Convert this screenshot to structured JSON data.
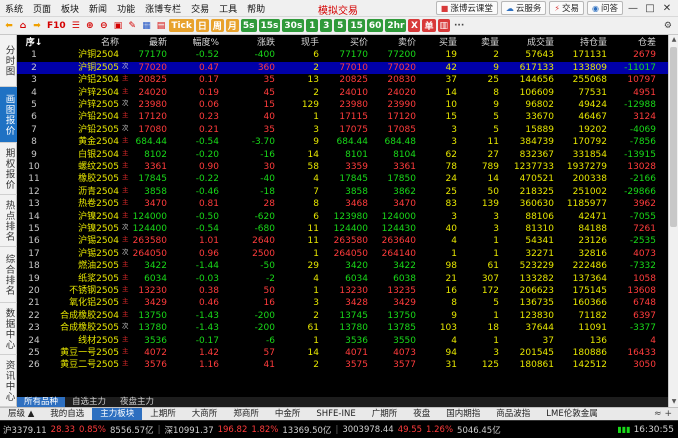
{
  "menu": {
    "items": [
      "系统",
      "页面",
      "板块",
      "新闻",
      "功能",
      "涨博专栏",
      "交易",
      "工具",
      "帮助"
    ],
    "title": "模拟交易",
    "right_buttons": [
      {
        "icon": "classroom-icon",
        "label": "涨博云课堂"
      },
      {
        "icon": "cloud-icon",
        "label": "云服务"
      },
      {
        "icon": "trade-icon",
        "label": "交易"
      },
      {
        "icon": "question-icon",
        "label": "问答"
      }
    ],
    "window_controls": [
      "—",
      "□",
      "✕"
    ]
  },
  "toolbar": {
    "f10": "F10",
    "tick": "Tick",
    "day": "日",
    "week": "周",
    "month": "月",
    "periods": [
      "5s",
      "15s",
      "30s",
      "1",
      "3",
      "5",
      "15",
      "60",
      "2hr"
    ],
    "x_btn": "X",
    "ex_btn": "单",
    "more": "···"
  },
  "sidebar": {
    "items": [
      "分时图",
      "画图报价",
      "期权报价",
      "热点排名",
      "综合排名",
      "数据中心",
      "资讯中心"
    ],
    "active_index": 1
  },
  "table": {
    "headers": {
      "seq": "序↓",
      "name": "名称",
      "last": "最新",
      "pct": "幅度%",
      "chg": "涨跌",
      "vol": "现手",
      "bid": "买价",
      "ask": "卖价",
      "bsz": "买量",
      "asz": "卖量",
      "turn": "成交量",
      "oi": "持仓量",
      "oichg": "仓差"
    },
    "selected_row": 1,
    "rows": [
      {
        "seq": "1",
        "name": "沪铜2504",
        "tag": "",
        "last": "77170",
        "pct": "-0.52",
        "chg": "-400",
        "vol": "6",
        "bid": "77170",
        "ask": "77200",
        "bsz": "19",
        "asz": "2",
        "turn": "57643",
        "oi": "171131",
        "oichg": "2679",
        "dir": "dn",
        "oidir": "up"
      },
      {
        "seq": "2",
        "name": "沪铜2505",
        "tag": "次",
        "last": "77020",
        "pct": "0.47",
        "chg": "360",
        "vol": "2",
        "bid": "77010",
        "ask": "77020",
        "bsz": "42",
        "asz": "9",
        "turn": "617133",
        "oi": "133809",
        "oichg": "-11017",
        "dir": "up",
        "oidir": "dn"
      },
      {
        "seq": "3",
        "name": "沪铝2504",
        "tag": "主",
        "last": "20825",
        "pct": "0.17",
        "chg": "35",
        "vol": "13",
        "bid": "20825",
        "ask": "20830",
        "bsz": "37",
        "asz": "25",
        "turn": "144656",
        "oi": "255068",
        "oichg": "10797",
        "dir": "up",
        "oidir": "up"
      },
      {
        "seq": "4",
        "name": "沪锌2504",
        "tag": "主",
        "last": "24020",
        "pct": "0.19",
        "chg": "45",
        "vol": "2",
        "bid": "24010",
        "ask": "24020",
        "bsz": "14",
        "asz": "8",
        "turn": "106609",
        "oi": "77531",
        "oichg": "4951",
        "dir": "up",
        "oidir": "up"
      },
      {
        "seq": "5",
        "name": "沪锌2505",
        "tag": "次",
        "last": "23980",
        "pct": "0.06",
        "chg": "15",
        "vol": "129",
        "bid": "23980",
        "ask": "23990",
        "bsz": "10",
        "asz": "9",
        "turn": "96802",
        "oi": "49424",
        "oichg": "-12988",
        "dir": "up",
        "oidir": "dn"
      },
      {
        "seq": "6",
        "name": "沪铅2504",
        "tag": "主",
        "last": "17120",
        "pct": "0.23",
        "chg": "40",
        "vol": "1",
        "bid": "17115",
        "ask": "17120",
        "bsz": "15",
        "asz": "5",
        "turn": "33670",
        "oi": "46467",
        "oichg": "3124",
        "dir": "up",
        "oidir": "up"
      },
      {
        "seq": "7",
        "name": "沪铅2505",
        "tag": "次",
        "last": "17080",
        "pct": "0.21",
        "chg": "35",
        "vol": "3",
        "bid": "17075",
        "ask": "17085",
        "bsz": "3",
        "asz": "5",
        "turn": "15889",
        "oi": "19202",
        "oichg": "-4069",
        "dir": "up",
        "oidir": "dn"
      },
      {
        "seq": "8",
        "name": "黄金2504",
        "tag": "主",
        "last": "684.44",
        "pct": "-0.54",
        "chg": "-3.70",
        "vol": "9",
        "bid": "684.44",
        "ask": "684.48",
        "bsz": "3",
        "asz": "11",
        "turn": "384739",
        "oi": "170792",
        "oichg": "-7856",
        "dir": "dn",
        "oidir": "dn"
      },
      {
        "seq": "9",
        "name": "白银2504",
        "tag": "主",
        "last": "8102",
        "pct": "-0.20",
        "chg": "-16",
        "vol": "14",
        "bid": "8101",
        "ask": "8104",
        "bsz": "62",
        "asz": "27",
        "turn": "832367",
        "oi": "331854",
        "oichg": "-13915",
        "dir": "dn",
        "oidir": "dn"
      },
      {
        "seq": "10",
        "name": "螺纹2505",
        "tag": "主",
        "last": "3361",
        "pct": "0.90",
        "chg": "30",
        "vol": "58",
        "bid": "3359",
        "ask": "3361",
        "bsz": "78",
        "asz": "789",
        "turn": "1237733",
        "oi": "1937279",
        "oichg": "13028",
        "dir": "up",
        "oidir": "up"
      },
      {
        "seq": "11",
        "name": "橡胶2505",
        "tag": "主",
        "last": "17845",
        "pct": "-0.22",
        "chg": "-40",
        "vol": "4",
        "bid": "17845",
        "ask": "17850",
        "bsz": "24",
        "asz": "14",
        "turn": "470521",
        "oi": "200338",
        "oichg": "-2166",
        "dir": "dn",
        "oidir": "dn"
      },
      {
        "seq": "12",
        "name": "沥青2504",
        "tag": "主",
        "last": "3858",
        "pct": "-0.46",
        "chg": "-18",
        "vol": "7",
        "bid": "3858",
        "ask": "3862",
        "bsz": "25",
        "asz": "50",
        "turn": "218325",
        "oi": "251002",
        "oichg": "-29866",
        "dir": "dn",
        "oidir": "dn"
      },
      {
        "seq": "13",
        "name": "热卷2505",
        "tag": "主",
        "last": "3470",
        "pct": "0.81",
        "chg": "28",
        "vol": "8",
        "bid": "3468",
        "ask": "3470",
        "bsz": "83",
        "asz": "139",
        "turn": "360630",
        "oi": "1185977",
        "oichg": "3962",
        "dir": "up",
        "oidir": "up"
      },
      {
        "seq": "14",
        "name": "沪镍2504",
        "tag": "主",
        "last": "124000",
        "pct": "-0.50",
        "chg": "-620",
        "vol": "6",
        "bid": "123980",
        "ask": "124000",
        "bsz": "3",
        "asz": "3",
        "turn": "88106",
        "oi": "42471",
        "oichg": "-7055",
        "dir": "dn",
        "oidir": "dn"
      },
      {
        "seq": "15",
        "name": "沪镍2505",
        "tag": "次",
        "last": "124400",
        "pct": "-0.54",
        "chg": "-680",
        "vol": "11",
        "bid": "124400",
        "ask": "124430",
        "bsz": "40",
        "asz": "3",
        "turn": "81310",
        "oi": "84188",
        "oichg": "7261",
        "dir": "dn",
        "oidir": "up"
      },
      {
        "seq": "16",
        "name": "沪锡2504",
        "tag": "主",
        "last": "263580",
        "pct": "1.01",
        "chg": "2640",
        "vol": "11",
        "bid": "263580",
        "ask": "263640",
        "bsz": "4",
        "asz": "1",
        "turn": "54341",
        "oi": "23126",
        "oichg": "-2535",
        "dir": "up",
        "oidir": "dn"
      },
      {
        "seq": "17",
        "name": "沪锡2505",
        "tag": "次",
        "last": "264050",
        "pct": "0.96",
        "chg": "2500",
        "vol": "1",
        "bid": "264050",
        "ask": "264140",
        "bsz": "1",
        "asz": "1",
        "turn": "32271",
        "oi": "32816",
        "oichg": "4073",
        "dir": "up",
        "oidir": "up"
      },
      {
        "seq": "18",
        "name": "燃油2505",
        "tag": "主",
        "last": "3422",
        "pct": "-1.44",
        "chg": "-50",
        "vol": "29",
        "bid": "3420",
        "ask": "3422",
        "bsz": "98",
        "asz": "61",
        "turn": "523229",
        "oi": "222486",
        "oichg": "-7332",
        "dir": "dn",
        "oidir": "dn"
      },
      {
        "seq": "19",
        "name": "纸浆2505",
        "tag": "主",
        "last": "6034",
        "pct": "-0.03",
        "chg": "-2",
        "vol": "4",
        "bid": "6034",
        "ask": "6038",
        "bsz": "21",
        "asz": "307",
        "turn": "133282",
        "oi": "137364",
        "oichg": "1058",
        "dir": "dn",
        "oidir": "up"
      },
      {
        "seq": "20",
        "name": "不锈钢2505",
        "tag": "主",
        "last": "13230",
        "pct": "0.38",
        "chg": "50",
        "vol": "1",
        "bid": "13230",
        "ask": "13235",
        "bsz": "16",
        "asz": "172",
        "turn": "206623",
        "oi": "175145",
        "oichg": "13608",
        "dir": "up",
        "oidir": "up"
      },
      {
        "seq": "21",
        "name": "氧化铝2505",
        "tag": "主",
        "last": "3429",
        "pct": "0.46",
        "chg": "16",
        "vol": "3",
        "bid": "3428",
        "ask": "3429",
        "bsz": "8",
        "asz": "5",
        "turn": "136735",
        "oi": "160366",
        "oichg": "6748",
        "dir": "up",
        "oidir": "up"
      },
      {
        "seq": "22",
        "name": "合成橡胶2504",
        "tag": "主",
        "last": "13750",
        "pct": "-1.43",
        "chg": "-200",
        "vol": "2",
        "bid": "13745",
        "ask": "13750",
        "bsz": "9",
        "asz": "1",
        "turn": "123830",
        "oi": "71182",
        "oichg": "6397",
        "dir": "dn",
        "oidir": "up"
      },
      {
        "seq": "23",
        "name": "合成橡胶2505",
        "tag": "次",
        "last": "13780",
        "pct": "-1.43",
        "chg": "-200",
        "vol": "61",
        "bid": "13780",
        "ask": "13785",
        "bsz": "103",
        "asz": "18",
        "turn": "37644",
        "oi": "11091",
        "oichg": "-3377",
        "dir": "dn",
        "oidir": "dn"
      },
      {
        "seq": "24",
        "name": "线材2505",
        "tag": "主",
        "last": "3536",
        "pct": "-0.17",
        "chg": "-6",
        "vol": "1",
        "bid": "3536",
        "ask": "3550",
        "bsz": "4",
        "asz": "1",
        "turn": "37",
        "oi": "136",
        "oichg": "4",
        "dir": "dn",
        "oidir": "up"
      },
      {
        "seq": "25",
        "name": "黄豆一号2505",
        "tag": "主",
        "last": "4072",
        "pct": "1.42",
        "chg": "57",
        "vol": "14",
        "bid": "4071",
        "ask": "4073",
        "bsz": "94",
        "asz": "3",
        "turn": "201545",
        "oi": "180886",
        "oichg": "16433",
        "dir": "up",
        "oidir": "up"
      },
      {
        "seq": "26",
        "name": "黄豆二号2505",
        "tag": "主",
        "last": "3576",
        "pct": "1.16",
        "chg": "41",
        "vol": "2",
        "bid": "3575",
        "ask": "3577",
        "bsz": "31",
        "asz": "125",
        "turn": "180861",
        "oi": "142512",
        "oichg": "3050",
        "dir": "up",
        "oidir": "up"
      }
    ]
  },
  "subtabs": {
    "items": [
      "所有品种",
      "自选主力",
      "夜盘主力"
    ],
    "active_index": 0
  },
  "boardtabs": {
    "items": [
      "层级 ▲",
      "我的自选",
      "主力板块",
      "上期所",
      "大商所",
      "郑商所",
      "中金所",
      "SHFE-INE",
      "广期所",
      "夜盘",
      "国内期指",
      "商品波指",
      "LME伦敦金属"
    ],
    "active_index": 2,
    "tail": "≈ +"
  },
  "status": {
    "segments": [
      {
        "text": "沪3379.11",
        "color": "w"
      },
      {
        "text": "28.33",
        "color": "r"
      },
      {
        "text": "0.85%",
        "color": "r"
      },
      {
        "text": "8556.57亿",
        "color": "w"
      },
      {
        "text": "|",
        "color": "sep"
      },
      {
        "text": "深10991.37",
        "color": "w"
      },
      {
        "text": "196.82",
        "color": "r"
      },
      {
        "text": "1.82%",
        "color": "r"
      },
      {
        "text": "13369.50亿",
        "color": "w"
      },
      {
        "text": "|",
        "color": "sep"
      },
      {
        "text": "3003978.44",
        "color": "w"
      },
      {
        "text": "49.55",
        "color": "r"
      },
      {
        "text": "1.26%",
        "color": "r"
      },
      {
        "text": "5046.45亿",
        "color": "w"
      }
    ],
    "signal": "▮▮▮",
    "time": "16:30:55"
  }
}
